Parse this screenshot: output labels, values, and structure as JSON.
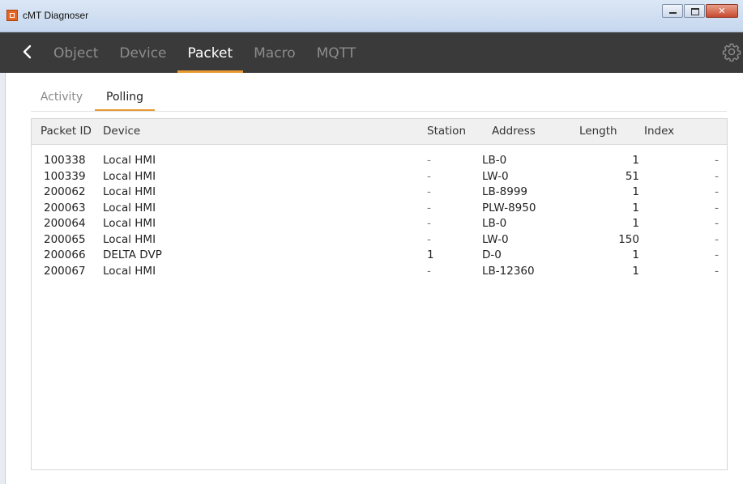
{
  "window": {
    "title": "cMT Diagnoser"
  },
  "nav": {
    "tabs": [
      {
        "label": "Object",
        "active": false
      },
      {
        "label": "Device",
        "active": false
      },
      {
        "label": "Packet",
        "active": true
      },
      {
        "label": "Macro",
        "active": false
      },
      {
        "label": "MQTT",
        "active": false
      }
    ]
  },
  "subtabs": [
    {
      "label": "Activity",
      "active": false
    },
    {
      "label": "Polling",
      "active": true
    }
  ],
  "table": {
    "columns": [
      "Packet ID",
      "Device",
      "Station",
      "Address",
      "Length",
      "Index"
    ],
    "rows": [
      {
        "packet_id": "100338",
        "device": "Local HMI",
        "station": "-",
        "address": "LB-0",
        "length": "1",
        "index": "-"
      },
      {
        "packet_id": "100339",
        "device": "Local HMI",
        "station": "-",
        "address": "LW-0",
        "length": "51",
        "index": "-"
      },
      {
        "packet_id": "200062",
        "device": "Local HMI",
        "station": "-",
        "address": "LB-8999",
        "length": "1",
        "index": "-"
      },
      {
        "packet_id": "200063",
        "device": "Local HMI",
        "station": "-",
        "address": "PLW-8950",
        "length": "1",
        "index": "-"
      },
      {
        "packet_id": "200064",
        "device": "Local HMI",
        "station": "-",
        "address": "LB-0",
        "length": "1",
        "index": "-"
      },
      {
        "packet_id": "200065",
        "device": "Local HMI",
        "station": "-",
        "address": "LW-0",
        "length": "150",
        "index": "-"
      },
      {
        "packet_id": "200066",
        "device": "DELTA DVP",
        "station": "1",
        "address": "D-0",
        "length": "1",
        "index": "-"
      },
      {
        "packet_id": "200067",
        "device": "Local HMI",
        "station": "-",
        "address": "LB-12360",
        "length": "1",
        "index": "-"
      }
    ]
  },
  "colors": {
    "accent": "#e89a32",
    "nav_bg": "#3a3a3a"
  },
  "icons": {
    "app": "app-icon",
    "back": "back-chevron-icon",
    "settings": "gear-icon"
  }
}
